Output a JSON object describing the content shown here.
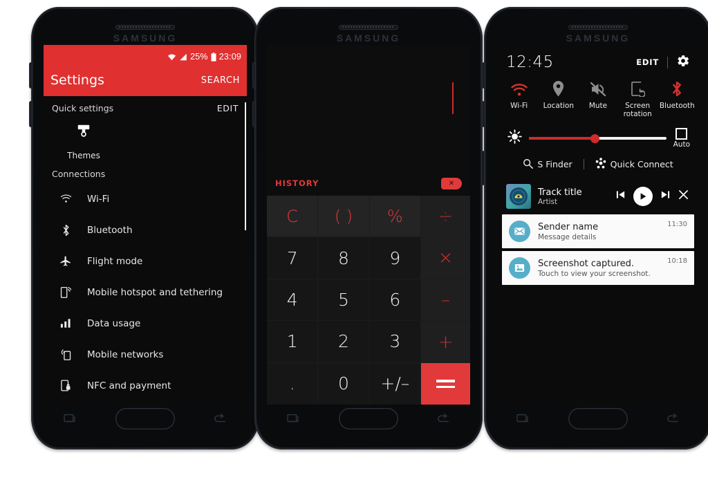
{
  "brand": "SAMSUNG",
  "accent_red": "#e03030",
  "phone1": {
    "name": "settings-phone",
    "statusbar": {
      "icons": [
        "wifi-icon",
        "signal-icon",
        "battery-icon"
      ],
      "battery_text": "25%",
      "clock": "23:09"
    },
    "appbar": {
      "title": "Settings",
      "action": "SEARCH"
    },
    "quick_settings": {
      "title": "Quick settings",
      "edit": "EDIT",
      "tiles": [
        {
          "icon": "themes-brush-icon",
          "label": "Themes"
        }
      ]
    },
    "connections": {
      "title": "Connections",
      "items": [
        {
          "icon": "wifi-icon",
          "label": "Wi-Fi"
        },
        {
          "icon": "bluetooth-icon",
          "label": "Bluetooth"
        },
        {
          "icon": "airplane-icon",
          "label": "Flight mode"
        },
        {
          "icon": "hotspot-icon",
          "label": "Mobile hotspot and tethering"
        },
        {
          "icon": "bars-icon",
          "label": "Data usage"
        },
        {
          "icon": "mobile-networks-icon",
          "label": "Mobile networks"
        },
        {
          "icon": "nfc-icon",
          "label": "NFC and payment"
        }
      ]
    }
  },
  "phone2": {
    "name": "calculator-phone",
    "display": {
      "expression": "",
      "history_label": "HISTORY",
      "delete_icon": "backspace-icon"
    },
    "keys": {
      "functions": [
        "C",
        "( )",
        "%"
      ],
      "rows": [
        [
          "7",
          "8",
          "9"
        ],
        [
          "4",
          "5",
          "6"
        ],
        [
          "1",
          "2",
          "3"
        ],
        [
          ".",
          "0",
          "+/–"
        ]
      ],
      "operators": [
        "÷",
        "×",
        "–",
        "+"
      ],
      "equals": "="
    }
  },
  "phone3": {
    "name": "notification-panel-phone",
    "clock": "12:45",
    "edit": "EDIT",
    "settings_icon": "gear-icon",
    "toggles": [
      {
        "icon": "wifi-icon",
        "label": "Wi-Fi",
        "active": true
      },
      {
        "icon": "location-pin-icon",
        "label": "Location",
        "active": false
      },
      {
        "icon": "mute-icon",
        "label": "Mute",
        "active": false
      },
      {
        "icon": "screen-rotation-icon",
        "label": "Screen rotation",
        "active": false
      },
      {
        "icon": "bluetooth-icon",
        "label": "Bluetooth",
        "active": true
      }
    ],
    "brightness": {
      "icon": "brightness-icon",
      "value_pct": 48,
      "auto_label": "Auto",
      "auto_checked": false
    },
    "links": [
      {
        "icon": "search-icon",
        "label": "S Finder"
      },
      {
        "icon": "quick-connect-icon",
        "label": "Quick Connect"
      }
    ],
    "media": {
      "album_art": "vinyl-record-icon",
      "title": "Track title",
      "artist": "Artist",
      "controls": [
        "prev-icon",
        "play-icon",
        "next-icon",
        "close-icon"
      ]
    },
    "notifications": [
      {
        "icon": "message-icon",
        "title": "Sender name",
        "subtitle": "Message details",
        "time": "11:30"
      },
      {
        "icon": "image-icon",
        "title": "Screenshot captured.",
        "subtitle": "Touch to view your screenshot.",
        "time": "10:18"
      }
    ]
  }
}
